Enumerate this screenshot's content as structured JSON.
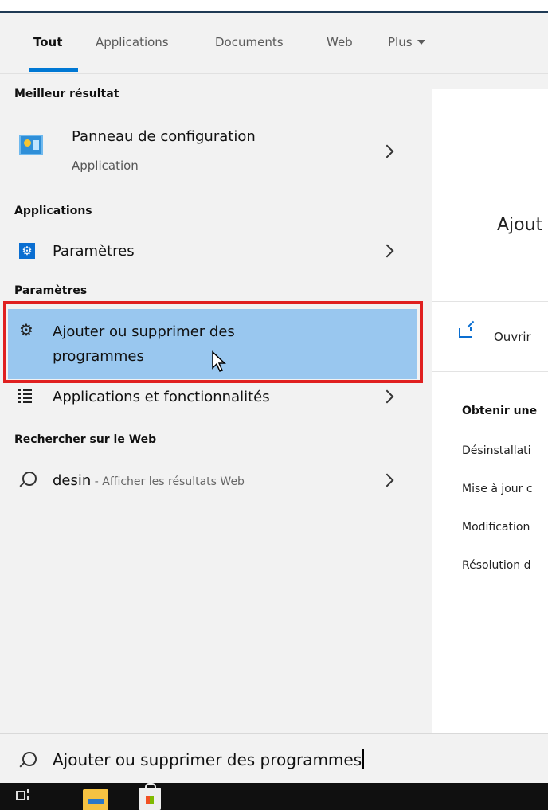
{
  "tabs": {
    "items": [
      {
        "label": "Tout",
        "active": true
      },
      {
        "label": "Applications"
      },
      {
        "label": "Documents"
      },
      {
        "label": "Web"
      },
      {
        "label": "Plus"
      }
    ]
  },
  "sections": {
    "best": "Meilleur résultat",
    "apps": "Applications",
    "settings": "Paramètres",
    "web": "Rechercher sur le Web"
  },
  "results": {
    "control_panel": {
      "label": "Panneau de configuration",
      "sub": "Application"
    },
    "settings_app": {
      "label": "Paramètres"
    },
    "add_remove": {
      "line1": "Ajouter ou supprimer des",
      "line2": "programmes"
    },
    "apps_features": {
      "label": "Applications et fonctionnalités"
    },
    "web_search": {
      "query": "desin",
      "suffix": " - Afficher les résultats Web"
    }
  },
  "preview": {
    "title": "Ajout",
    "open_label": "Ouvrir",
    "help_title": "Obtenir une",
    "links": [
      "Désinstallati",
      "Mise à jour c",
      "Modification",
      "Résolution d"
    ]
  },
  "search": {
    "value": "Ajouter ou supprimer des programmes"
  },
  "colors": {
    "selected": "#99c7ef",
    "outline": "#e02020",
    "accent": "#0078d4"
  }
}
